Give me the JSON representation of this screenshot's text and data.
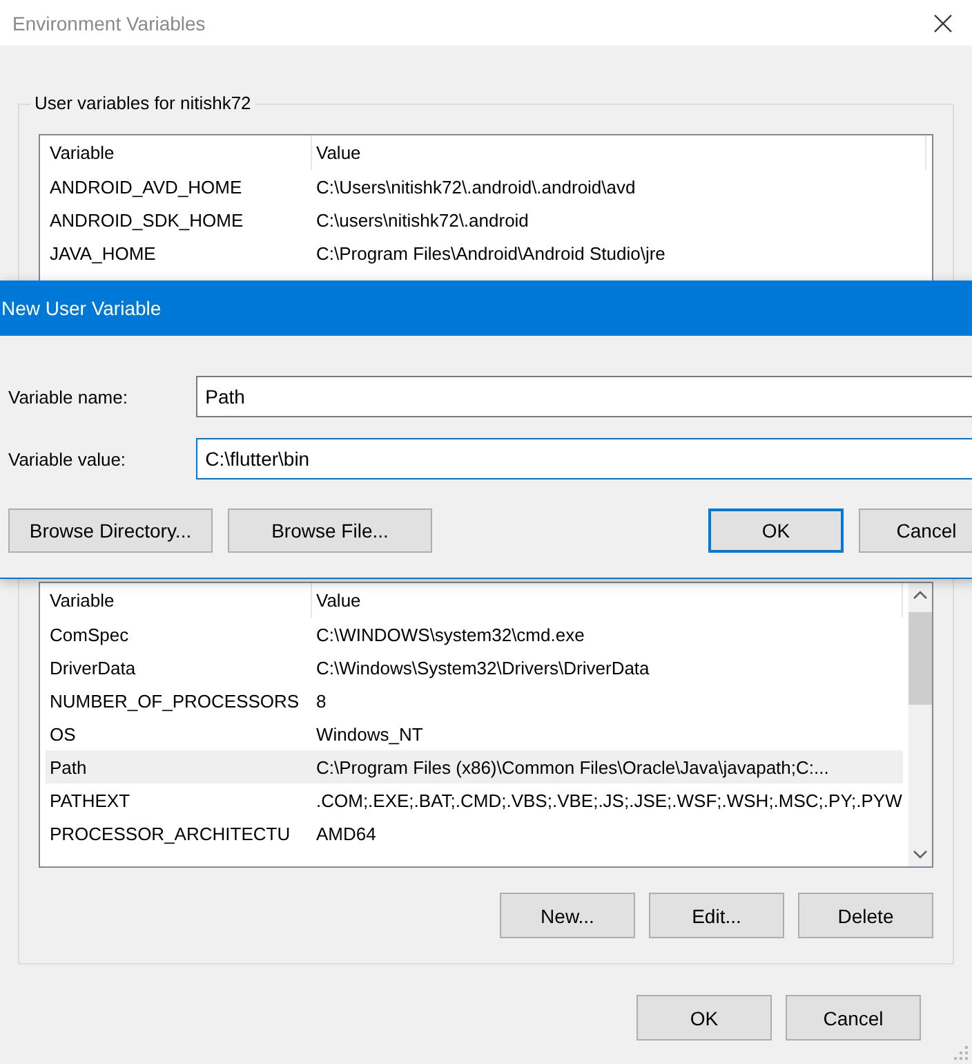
{
  "window": {
    "title": "Environment Variables"
  },
  "user_variables": {
    "title": "User variables for nitishk72",
    "columns": [
      "Variable",
      "Value"
    ],
    "rows": [
      {
        "variable": "ANDROID_AVD_HOME",
        "value": "C:\\Users\\nitishk72\\.android\\.android\\avd",
        "selected": false
      },
      {
        "variable": "ANDROID_SDK_HOME",
        "value": "C:\\users\\nitishk72\\.android",
        "selected": false
      },
      {
        "variable": "JAVA_HOME",
        "value": "C:\\Program Files\\Android\\Android Studio\\jre",
        "selected": false
      }
    ]
  },
  "system_variables": {
    "columns": [
      "Variable",
      "Value"
    ],
    "rows": [
      {
        "variable": "ComSpec",
        "value": "C:\\WINDOWS\\system32\\cmd.exe",
        "selected": false
      },
      {
        "variable": "DriverData",
        "value": "C:\\Windows\\System32\\Drivers\\DriverData",
        "selected": false
      },
      {
        "variable": "NUMBER_OF_PROCESSORS",
        "value": "8",
        "selected": false
      },
      {
        "variable": "OS",
        "value": "Windows_NT",
        "selected": false
      },
      {
        "variable": "Path",
        "value": "C:\\Program Files (x86)\\Common Files\\Oracle\\Java\\javapath;C:...",
        "selected": true
      },
      {
        "variable": "PATHEXT",
        "value": ".COM;.EXE;.BAT;.CMD;.VBS;.VBE;.JS;.JSE;.WSF;.WSH;.MSC;.PY;.PYW",
        "selected": false
      },
      {
        "variable": "PROCESSOR_ARCHITECTU",
        "value": "AMD64",
        "selected": false
      }
    ],
    "buttons": [
      "New...",
      "Edit...",
      "Delete"
    ]
  },
  "footer_buttons": [
    "OK",
    "Cancel"
  ],
  "dialog": {
    "title": "New User Variable",
    "fields": [
      {
        "label": "Variable name:",
        "value": "Path",
        "focused": false
      },
      {
        "label": "Variable value:",
        "value": "C:\\flutter\\bin",
        "focused": true
      }
    ],
    "browse_buttons": [
      "Browse Directory...",
      "Browse File..."
    ],
    "buttons": [
      {
        "label": "OK",
        "default": true
      },
      {
        "label": "Cancel",
        "default": false
      }
    ]
  }
}
